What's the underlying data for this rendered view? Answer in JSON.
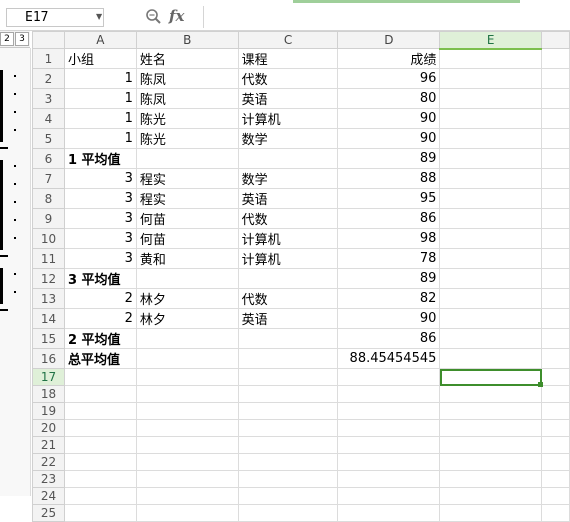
{
  "namebox": "E17",
  "formula": "",
  "outline_levels": [
    "2",
    "3"
  ],
  "columns": [
    "A",
    "B",
    "C",
    "D",
    "E"
  ],
  "selected_column": "E",
  "selected_row": "17",
  "rows": [
    {
      "n": "1",
      "a": "小组",
      "b": "姓名",
      "c": "课程",
      "d": "成绩",
      "e": ""
    },
    {
      "n": "2",
      "a": "1",
      "b": "陈凤",
      "c": "代数",
      "d": "96",
      "e": ""
    },
    {
      "n": "3",
      "a": "1",
      "b": "陈凤",
      "c": "英语",
      "d": "80",
      "e": ""
    },
    {
      "n": "4",
      "a": "1",
      "b": "陈光",
      "c": "计算机",
      "d": "90",
      "e": ""
    },
    {
      "n": "5",
      "a": "1",
      "b": "陈光",
      "c": "数学",
      "d": "90",
      "e": ""
    },
    {
      "n": "6",
      "a": "1  平均值",
      "b": "",
      "c": "",
      "d": "89",
      "e": ""
    },
    {
      "n": "7",
      "a": "3",
      "b": "程实",
      "c": "数学",
      "d": "88",
      "e": ""
    },
    {
      "n": "8",
      "a": "3",
      "b": "程实",
      "c": "英语",
      "d": "95",
      "e": ""
    },
    {
      "n": "9",
      "a": "3",
      "b": "何苗",
      "c": "代数",
      "d": "86",
      "e": ""
    },
    {
      "n": "10",
      "a": "3",
      "b": "何苗",
      "c": "计算机",
      "d": "98",
      "e": ""
    },
    {
      "n": "11",
      "a": "3",
      "b": "黄和",
      "c": "计算机",
      "d": "78",
      "e": ""
    },
    {
      "n": "12",
      "a": "3  平均值",
      "b": "",
      "c": "",
      "d": "89",
      "e": ""
    },
    {
      "n": "13",
      "a": "2",
      "b": "林夕",
      "c": "代数",
      "d": "82",
      "e": ""
    },
    {
      "n": "14",
      "a": "2",
      "b": "林夕",
      "c": "英语",
      "d": "90",
      "e": ""
    },
    {
      "n": "15",
      "a": "2  平均值",
      "b": "",
      "c": "",
      "d": "86",
      "e": ""
    },
    {
      "n": "16",
      "a": "总平均值",
      "b": "",
      "c": "",
      "d": "88.45454545",
      "e": ""
    },
    {
      "n": "17",
      "a": "",
      "b": "",
      "c": "",
      "d": "",
      "e": ""
    },
    {
      "n": "18",
      "a": "",
      "b": "",
      "c": "",
      "d": "",
      "e": ""
    },
    {
      "n": "19",
      "a": "",
      "b": "",
      "c": "",
      "d": "",
      "e": ""
    },
    {
      "n": "20",
      "a": "",
      "b": "",
      "c": "",
      "d": "",
      "e": ""
    },
    {
      "n": "21",
      "a": "",
      "b": "",
      "c": "",
      "d": "",
      "e": ""
    },
    {
      "n": "22",
      "a": "",
      "b": "",
      "c": "",
      "d": "",
      "e": ""
    },
    {
      "n": "23",
      "a": "",
      "b": "",
      "c": "",
      "d": "",
      "e": ""
    },
    {
      "n": "24",
      "a": "",
      "b": "",
      "c": "",
      "d": "",
      "e": ""
    },
    {
      "n": "25",
      "a": "",
      "b": "",
      "c": "",
      "d": "",
      "e": ""
    }
  ]
}
